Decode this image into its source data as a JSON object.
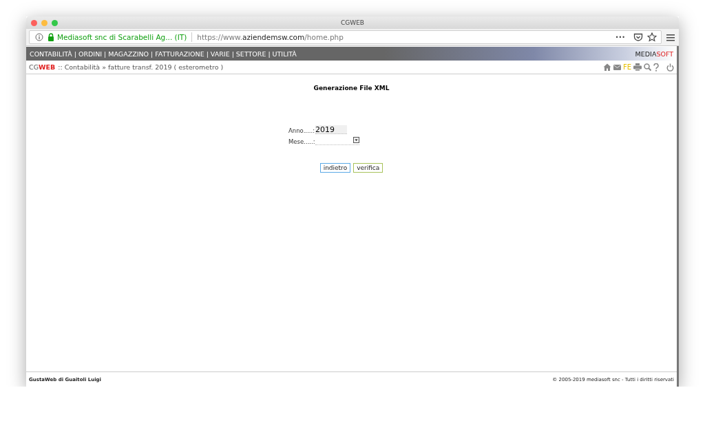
{
  "window": {
    "title": "CGWEB"
  },
  "address_bar": {
    "site_identity": "Mediasoft snc di Scarabelli Ag... (IT)",
    "url_parts": [
      {
        "text": "https://www.",
        "kind": "dim"
      },
      {
        "text": "aziendemsw.com",
        "kind": "strong"
      },
      {
        "text": "/home.php",
        "kind": "dim"
      }
    ],
    "more": "•••"
  },
  "nav": {
    "separator": "|",
    "items": [
      "CONTABILITÀ",
      "ORDINI",
      "MAGAZZINO",
      "FATTURAZIONE",
      "VARIE",
      "SETTORE",
      "UTILITÀ"
    ],
    "brand": [
      {
        "text": "MEDIA",
        "kind": "plain"
      },
      {
        "text": "SOFT",
        "kind": "accent"
      }
    ]
  },
  "breadcrumb": {
    "logo": [
      {
        "text": "CG",
        "kind": "plain"
      },
      {
        "text": "WEB",
        "kind": "accent"
      }
    ],
    "path": ":: Contabilità » fatture transf. 2019 ( esterometro )",
    "fe_label": "FE"
  },
  "form": {
    "title": "Generazione File XML",
    "fields": [
      {
        "label": "Anno.....:",
        "kind": "text",
        "value": "2019"
      },
      {
        "label": "Mese.....:",
        "kind": "select"
      }
    ],
    "buttons": [
      {
        "label": "indietro",
        "color": "#5aa9e6"
      },
      {
        "label": "verifica",
        "color": "#a8c25a"
      }
    ]
  },
  "footer": {
    "left": "GustaWeb di Guaitoli Luigi",
    "right": "© 2005-2019 mediasoft snc - Tutti i diritti riservati"
  }
}
